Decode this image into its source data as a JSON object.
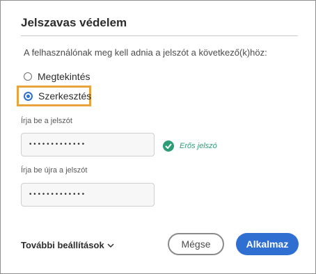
{
  "dialog": {
    "title": "Jelszavas védelem",
    "prompt": "A felhasználónak meg kell adnia a jelszót a következő(k)höz:",
    "options": [
      {
        "label": "Megtekintés",
        "selected": false
      },
      {
        "label": "Szerkesztés",
        "selected": true
      }
    ],
    "password": {
      "label": "Írja be a jelszót",
      "value": "•••••••••••••",
      "strength": "Erős jelszó"
    },
    "confirm": {
      "label": "Írja be újra a jelszót",
      "value": "•••••••••••••"
    },
    "more_settings": "További beállítások",
    "cancel_label": "Mégse",
    "apply_label": "Alkalmaz"
  },
  "colors": {
    "accent": "#2f6fd1",
    "success": "#2d9d78",
    "highlight": "#e8a33d"
  },
  "icons": {
    "strength": "checkmark-circle-icon",
    "more_settings": "chevron-down-icon"
  }
}
